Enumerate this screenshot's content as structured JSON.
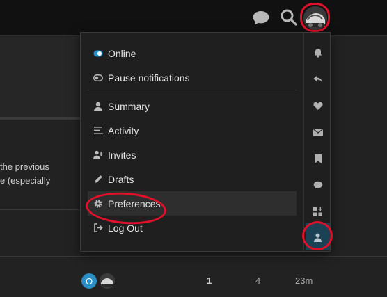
{
  "page_fragment": {
    "line1": "the previous",
    "line2": "e (especially"
  },
  "menu": {
    "items": [
      {
        "label": "Online",
        "icon": "toggle-on-icon"
      },
      {
        "label": "Pause notifications",
        "icon": "toggle-off-icon"
      },
      {
        "label": "Summary",
        "icon": "user-icon"
      },
      {
        "label": "Activity",
        "icon": "activity-lines-icon"
      },
      {
        "label": "Invites",
        "icon": "user-plus-icon"
      },
      {
        "label": "Drafts",
        "icon": "pencil-icon"
      },
      {
        "label": "Preferences",
        "icon": "gear-icon"
      },
      {
        "label": "Log Out",
        "icon": "sign-out-icon"
      }
    ],
    "side_tabs": [
      "bell-icon",
      "reply-icon",
      "heart-icon",
      "envelope-icon",
      "bookmark-icon",
      "chat-bubble-icon",
      "grid-plus-icon",
      "user-icon"
    ]
  },
  "post_row": {
    "avatar_letter": "O",
    "replies": "1",
    "views": "4",
    "activity": "23m"
  },
  "colors": {
    "accent": "#2a8fc7",
    "annotation_red": "#e0102a",
    "active_tab": "#1b4155"
  }
}
